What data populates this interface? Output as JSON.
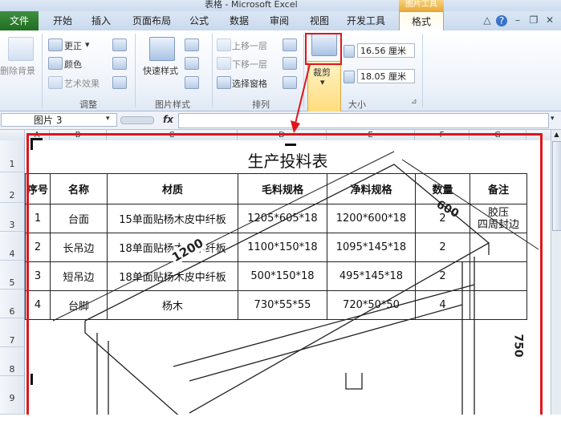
{
  "window": {
    "title": "表格 - Microsoft Excel",
    "picture_tools": "图片工具"
  },
  "tabs": [
    "文件",
    "开始",
    "插入",
    "页面布局",
    "公式",
    "数据",
    "审阅",
    "视图",
    "开发工具",
    "格式"
  ],
  "ribbon": {
    "remove_bg": "删除背景",
    "adjust": {
      "corrections": "更正",
      "color": "颜色",
      "artistic": "艺术效果",
      "label": "调整"
    },
    "styles": {
      "quick_styles": "快速样式",
      "label": "图片样式"
    },
    "arrange": {
      "bring_forward": "上移一层",
      "send_backward": "下移一层",
      "selection_pane": "选择窗格",
      "label": "排列"
    },
    "size": {
      "crop": "裁剪",
      "height": "16.56 厘米",
      "width": "18.05 厘米",
      "label": "大小"
    }
  },
  "formula_bar": {
    "name_box": "图片 3",
    "fx": "fx",
    "value": ""
  },
  "columns": [
    "A",
    "B",
    "C",
    "D",
    "E",
    "F",
    "G"
  ],
  "rows": [
    "1",
    "2",
    "3",
    "4",
    "5",
    "6",
    "7",
    "8",
    "9"
  ],
  "document": {
    "title": "生产投料表",
    "headers": [
      "序号",
      "名称",
      "材质",
      "毛料规格",
      "净料规格",
      "数量",
      "备注"
    ],
    "rows": [
      [
        "1",
        "台面",
        "15单面贴杨木皮中纤板",
        "1205*605*18",
        "1200*600*18",
        "2",
        "胶压\n四周封边"
      ],
      [
        "2",
        "长吊边",
        "18单面贴杨木皮中纤板",
        "1100*150*18",
        "1095*145*18",
        "2",
        ""
      ],
      [
        "3",
        "短吊边",
        "18单面贴杨木皮中纤板",
        "500*150*18",
        "495*145*18",
        "2",
        ""
      ],
      [
        "4",
        "台脚",
        "杨木",
        "730*55*55",
        "720*50*50",
        "4",
        ""
      ]
    ],
    "dim_labels": {
      "width": "1200",
      "depth": "600",
      "height": "750"
    }
  }
}
